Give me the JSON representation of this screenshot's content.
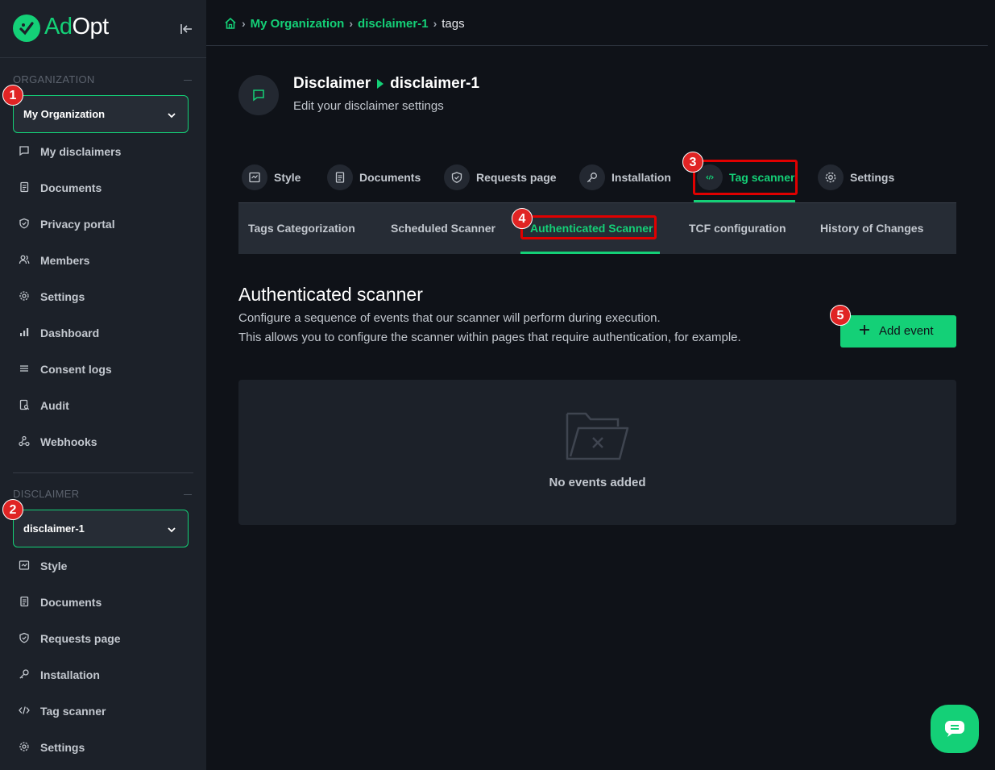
{
  "app": {
    "logo_part1": "Ad",
    "logo_part2": "Opt"
  },
  "breadcrumb": {
    "org": "My Organization",
    "disclaimer": "disclaimer-1",
    "current": "tags"
  },
  "sidebar": {
    "org_section_title": "ORGANIZATION",
    "org_select_value": "My Organization",
    "org_items": [
      {
        "label": "My disclaimers",
        "icon": "chat-square-icon"
      },
      {
        "label": "Documents",
        "icon": "document-icon"
      },
      {
        "label": "Privacy portal",
        "icon": "shield-icon"
      },
      {
        "label": "Members",
        "icon": "users-icon"
      },
      {
        "label": "Settings",
        "icon": "gear-icon"
      },
      {
        "label": "Dashboard",
        "icon": "bar-chart-icon"
      },
      {
        "label": "Consent logs",
        "icon": "list-icon"
      },
      {
        "label": "Audit",
        "icon": "audit-icon"
      },
      {
        "label": "Webhooks",
        "icon": "webhook-icon"
      }
    ],
    "disc_section_title": "DISCLAIMER",
    "disc_select_value": "disclaimer-1",
    "disc_items": [
      {
        "label": "Style",
        "icon": "style-icon"
      },
      {
        "label": "Documents",
        "icon": "document-icon"
      },
      {
        "label": "Requests page",
        "icon": "shield-icon"
      },
      {
        "label": "Installation",
        "icon": "key-icon"
      },
      {
        "label": "Tag scanner",
        "icon": "code-icon"
      },
      {
        "label": "Settings",
        "icon": "gear-icon"
      }
    ]
  },
  "header": {
    "title_part1": "Disclaimer",
    "title_part2": "disclaimer-1",
    "subtitle": "Edit your disclaimer settings"
  },
  "tabs": [
    {
      "label": "Style"
    },
    {
      "label": "Documents"
    },
    {
      "label": "Requests page"
    },
    {
      "label": "Installation"
    },
    {
      "label": "Tag scanner",
      "active": true
    },
    {
      "label": "Settings"
    }
  ],
  "subtabs": [
    {
      "label": "Tags Categorization"
    },
    {
      "label": "Scheduled Scanner"
    },
    {
      "label": "Authenticated Scanner",
      "active": true
    },
    {
      "label": "TCF configuration"
    },
    {
      "label": "History of Changes"
    }
  ],
  "section": {
    "title": "Authenticated scanner",
    "desc_line1": "Configure a sequence of events that our scanner will perform during execution.",
    "desc_line2": "This allows you to configure the scanner within pages that require authentication, for example.",
    "add_button": "Add event",
    "empty_text": "No events added"
  },
  "annotations": [
    "1",
    "2",
    "3",
    "4",
    "5"
  ],
  "colors": {
    "accent": "#14d077",
    "highlight": "#e00000",
    "sidebar_bg": "#1c2129",
    "page_bg": "#0f1218"
  }
}
